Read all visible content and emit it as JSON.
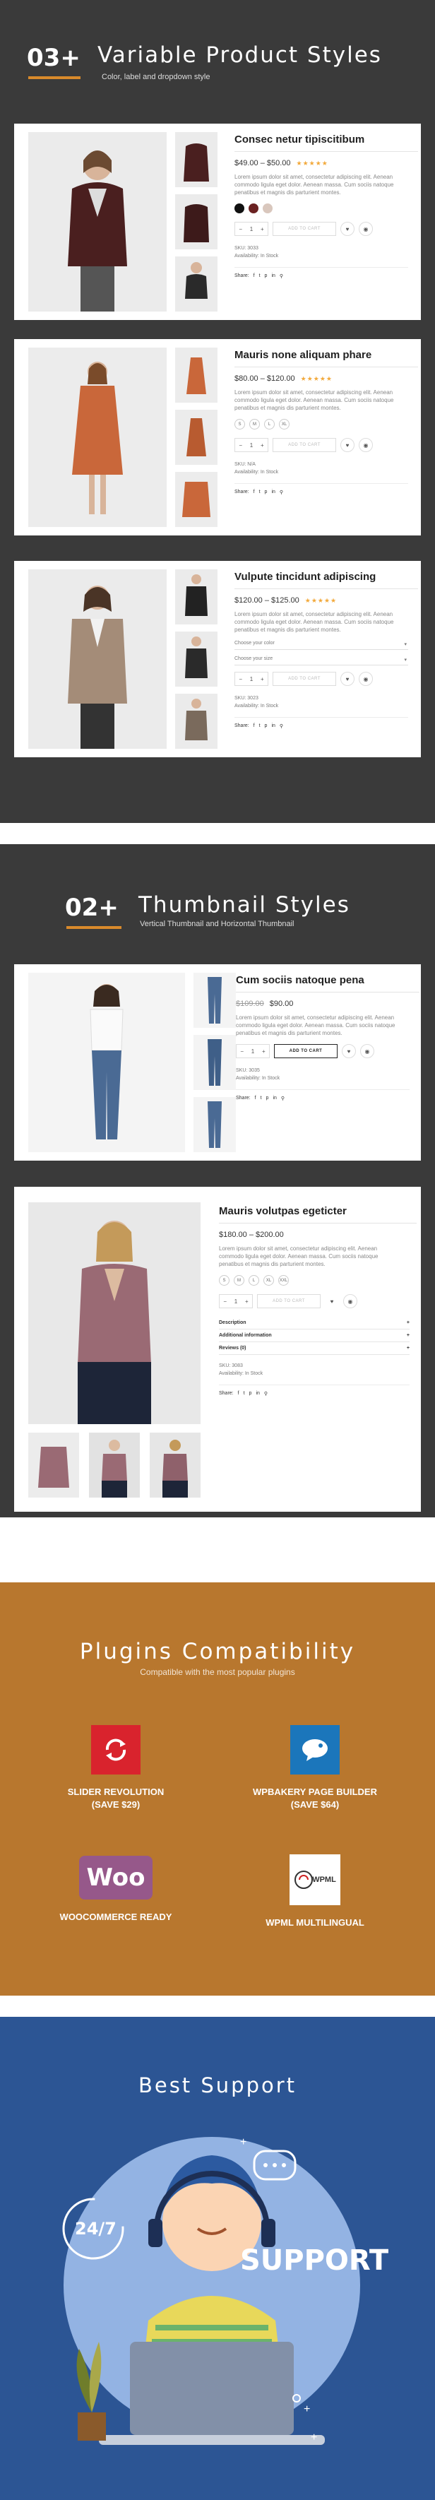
{
  "section_variable": {
    "num": "03+",
    "title": "Variable Product Styles",
    "subtitle": "Color, label and dropdown style"
  },
  "section_thumbnail": {
    "num": "02+",
    "title": "Thumbnail Styles",
    "subtitle": "Vertical Thumbnail and Horizontal Thumbnail"
  },
  "products": [
    {
      "title": "Consec netur tipiscitibum",
      "price": "$49.00 – $50.00",
      "desc": "Lorem ipsum dolor sit amet, consectetur adipiscing elit. Aenean commodo ligula eget dolor. Aenean massa. Cum sociis natoque penatibus et magnis dis parturient montes.",
      "qty": "1",
      "cart": "ADD TO CART",
      "sku": "SKU: 3033",
      "availability": "Availability: In Stock",
      "share": "Share:"
    },
    {
      "title": "Mauris none aliquam phare",
      "price": "$80.00 – $120.00",
      "desc": "Lorem ipsum dolor sit amet, consectetur adipiscing elit. Aenean commodo ligula eget dolor. Aenean massa. Cum sociis natoque penatibus et magnis dis parturient montes.",
      "sizes": [
        "S",
        "M",
        "L",
        "XL"
      ],
      "qty": "1",
      "cart": "ADD TO CART",
      "sku": "SKU: N/A",
      "availability": "Availability: In Stock",
      "share": "Share:"
    },
    {
      "title": "Vulpute tincidunt adipiscing",
      "price": "$120.00 – $125.00",
      "desc": "Lorem ipsum dolor sit amet, consectetur adipiscing elit. Aenean commodo ligula eget dolor. Aenean massa. Cum sociis natoque penatibus et magnis dis parturient montes.",
      "select1": "Choose your color",
      "select2": "Choose your size",
      "qty": "1",
      "cart": "ADD TO CART",
      "sku": "SKU: 3023",
      "availability": "Availability: In Stock",
      "share": "Share:"
    },
    {
      "title": "Cum sociis natoque pena",
      "old_price": "$109.00",
      "price": "$90.00",
      "desc": "Lorem ipsum dolor sit amet, consectetur adipiscing elit. Aenean commodo ligula eget dolor. Aenean massa. Cum sociis natoque penatibus et magnis dis parturient montes.",
      "qty": "1",
      "cart": "ADD TO CART",
      "sku": "SKU: 3035",
      "availability": "Availability: In Stock",
      "share": "Share:"
    },
    {
      "title": "Mauris volutpas egeticter",
      "price": "$180.00 – $200.00",
      "desc": "Lorem ipsum dolor sit amet, consectetur adipiscing elit. Aenean commodo ligula eget dolor. Aenean massa. Cum sociis natoque penatibus et magnis dis parturient montes.",
      "sizes": [
        "S",
        "M",
        "L",
        "XL",
        "XXL"
      ],
      "qty": "1",
      "cart": "ADD TO CART",
      "acc": [
        "Description",
        "Additional information",
        "Reviews (0)"
      ],
      "sku": "SKU: 3083",
      "availability": "Availability: In Stock",
      "share": "Share:"
    }
  ],
  "plugins": {
    "title": "Plugins Compatibility",
    "subtitle": "Compatible with the most popular plugins",
    "items": [
      {
        "line1": "SLIDER REVOLUTION",
        "line2": "(SAVE $29)",
        "icon": "slider-revolution-icon"
      },
      {
        "line1": "WPBAKERY PAGE BUILDER",
        "line2": "(SAVE $64)",
        "icon": "wpbakery-icon"
      },
      {
        "line1": "WOOCOMMERCE READY",
        "line2": "",
        "icon": "woocommerce-icon",
        "logo_text": "Woo"
      },
      {
        "line1": "WPML MULTILINGUAL",
        "line2": "",
        "icon": "wpml-icon",
        "logo_text": "WPML"
      }
    ]
  },
  "support": {
    "title": "Best Support",
    "big_text": "SUPPORT",
    "clock_text": "24/7"
  },
  "colors": {
    "dark_bg": "#3a3a3a",
    "accent": "#d98a2b",
    "plugins_bg": "#b8772e",
    "support_bg": "#2c5594",
    "slider_red": "#d9232d",
    "wpbakery_blue": "#1b76bb",
    "woo_purple": "#96588a"
  }
}
